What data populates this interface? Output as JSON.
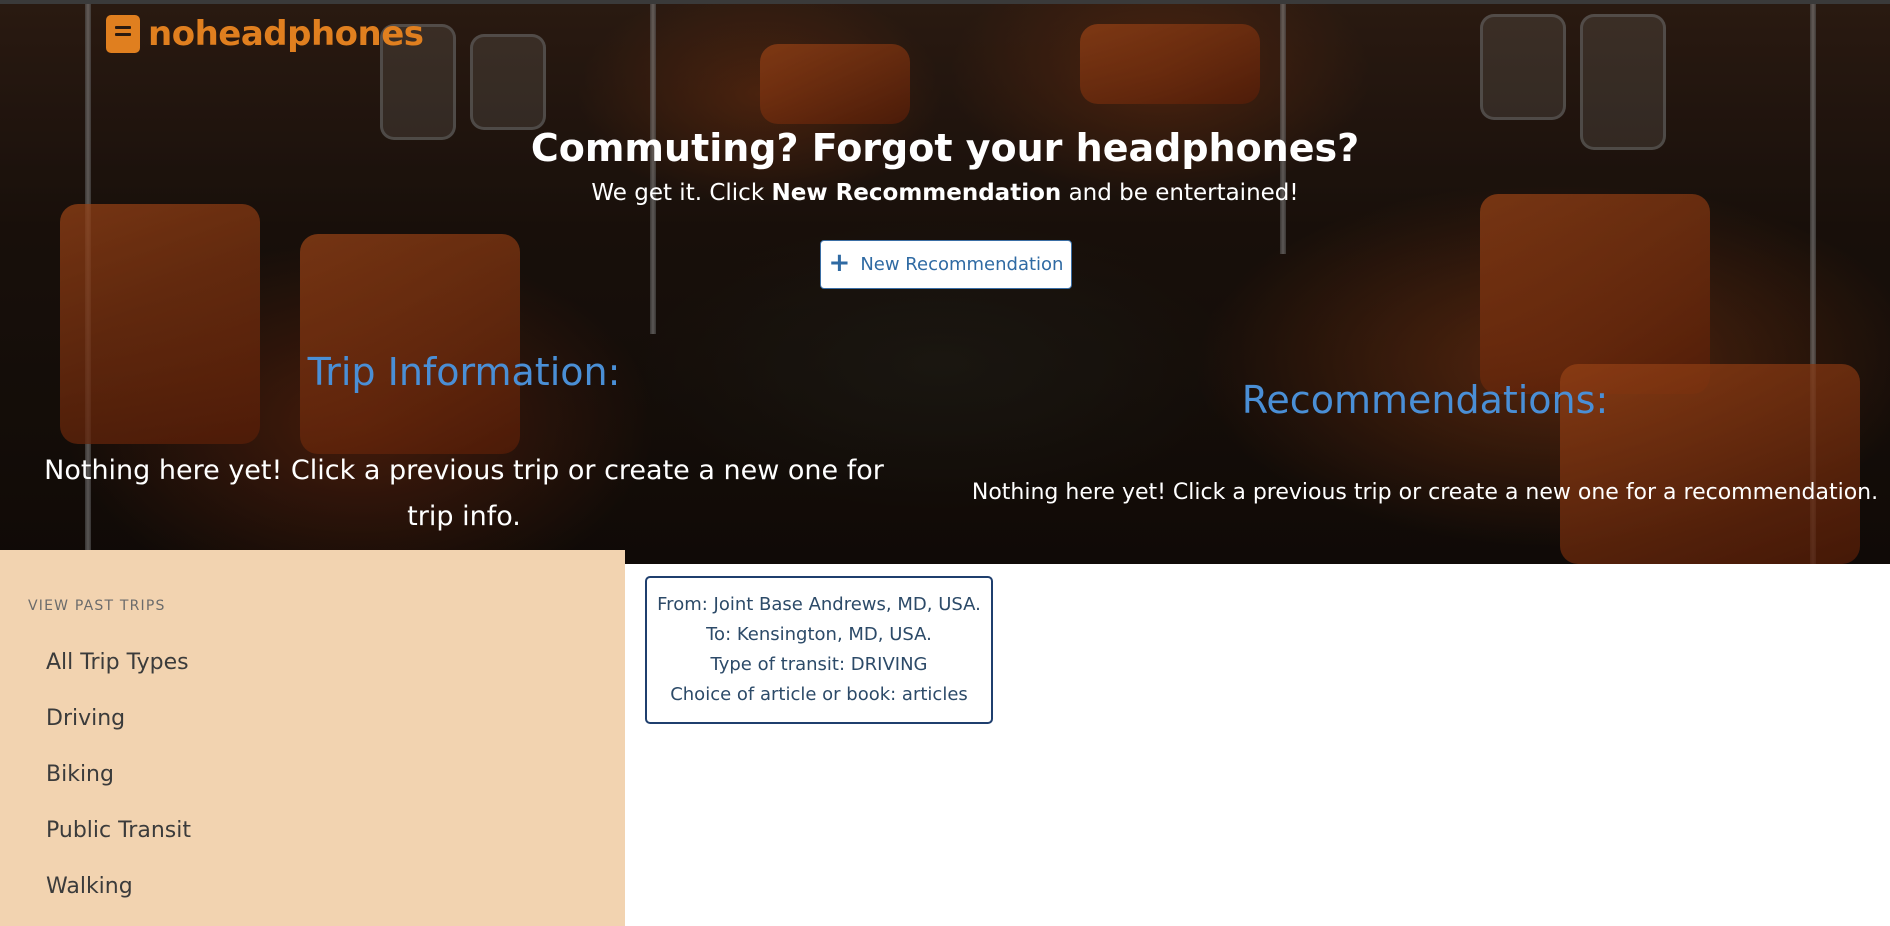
{
  "brand": {
    "name": "noheadphones",
    "icon": "book-icon",
    "color": "#e07f1f"
  },
  "hero": {
    "headline": "Commuting? Forgot your headphones?",
    "subline_prefix": "We get it. Click ",
    "subline_bold": "New Recommendation",
    "subline_suffix": " and be entertained!",
    "new_button_label": "New Recommendation",
    "new_button_icon": "plus-icon"
  },
  "trip_info": {
    "title": "Trip Information:",
    "empty_text": "Nothing here yet! Click a previous trip or create a new one for trip info."
  },
  "recommendations": {
    "title": "Recommendations:",
    "empty_text": "Nothing here yet! Click a previous trip or create a new one for a recommendation."
  },
  "sidebar": {
    "heading": "VIEW PAST TRIPS",
    "items": [
      {
        "label": "All Trip Types"
      },
      {
        "label": "Driving"
      },
      {
        "label": "Biking"
      },
      {
        "label": "Public Transit"
      },
      {
        "label": "Walking"
      }
    ]
  },
  "past_trips": [
    {
      "from": "From: Joint Base Andrews, MD, USA.",
      "to": "To: Kensington, MD, USA.",
      "transit": "Type of transit: DRIVING",
      "choice": "Choice of article or book: articles"
    }
  ],
  "colors": {
    "accent_blue": "#4a8fd6",
    "sidebar_bg": "#f2d3b0",
    "card_border": "#1f3f6e"
  }
}
